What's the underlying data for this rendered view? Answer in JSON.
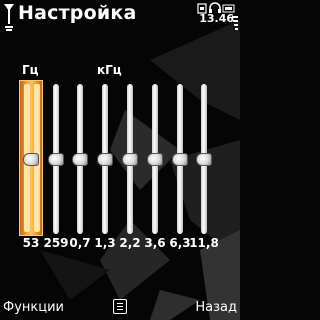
{
  "header": {
    "title": "Настройка",
    "clock": "13.46"
  },
  "units": {
    "hz": "Гц",
    "khz": "кГц"
  },
  "equalizer": {
    "bands": [
      {
        "label": "53",
        "level": 0.5,
        "selected": true
      },
      {
        "label": "259",
        "level": 0.5,
        "selected": false
      },
      {
        "label": "0,7",
        "level": 0.5,
        "selected": false
      },
      {
        "label": "1,3",
        "level": 0.5,
        "selected": false
      },
      {
        "label": "2,2",
        "level": 0.5,
        "selected": false
      },
      {
        "label": "3,6",
        "level": 0.5,
        "selected": false
      },
      {
        "label": "6,3",
        "level": 0.5,
        "selected": false
      },
      {
        "label": "11,8",
        "level": 0.5,
        "selected": false
      }
    ]
  },
  "softkeys": {
    "left": "Функции",
    "right": "Назад",
    "center_icon": "menu-icon"
  },
  "colors": {
    "selected_band": "#f8a230",
    "background": "#050505"
  }
}
